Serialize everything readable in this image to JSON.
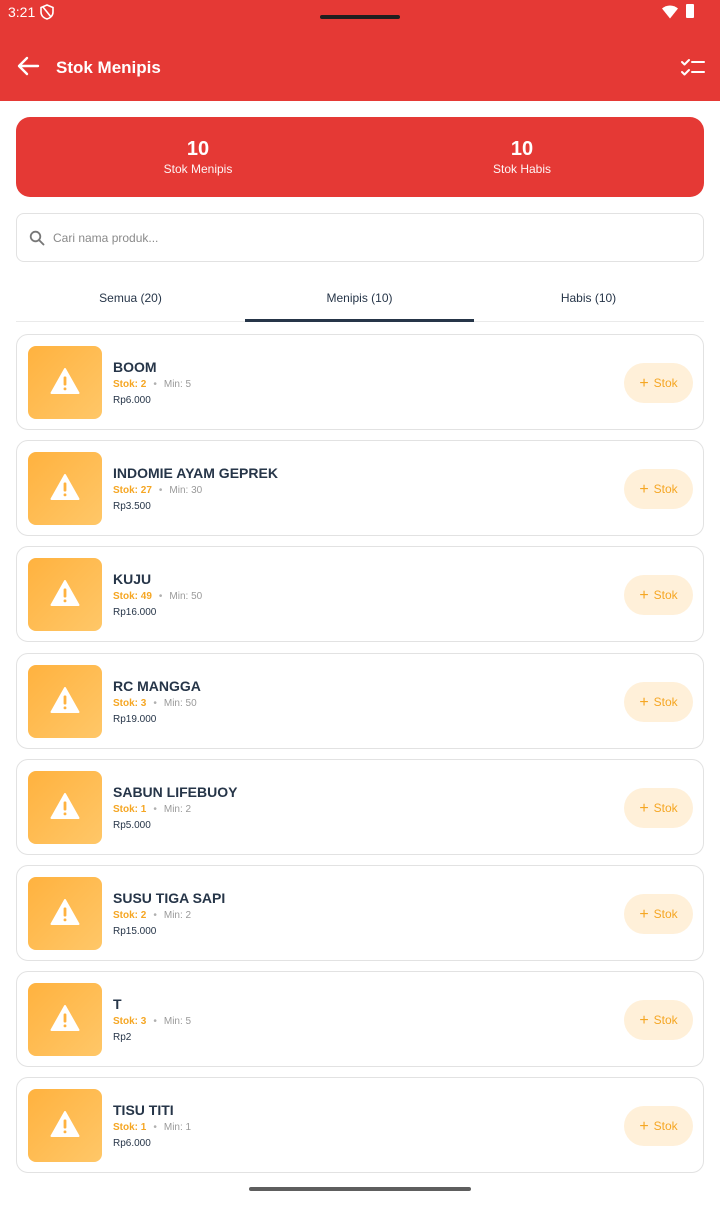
{
  "status_bar": {
    "time": "3:21"
  },
  "header": {
    "title": "Stok Menipis"
  },
  "summary": [
    {
      "value": "10",
      "label": "Stok Menipis"
    },
    {
      "value": "10",
      "label": "Stok Habis"
    }
  ],
  "search": {
    "placeholder": "Cari nama produk...",
    "value": ""
  },
  "tabs": [
    {
      "label": "Semua (20)",
      "active": false
    },
    {
      "label": "Menipis (10)",
      "active": true
    },
    {
      "label": "Habis (10)",
      "active": false
    }
  ],
  "products": [
    {
      "name": "BOOM",
      "stock": "Stok: 2",
      "min": "Min: 5",
      "price": "Rp6.000"
    },
    {
      "name": "INDOMIE AYAM GEPREK",
      "stock": "Stok: 27",
      "min": "Min: 30",
      "price": "Rp3.500"
    },
    {
      "name": "KUJU",
      "stock": "Stok: 49",
      "min": "Min: 50",
      "price": "Rp16.000"
    },
    {
      "name": "RC MANGGA",
      "stock": "Stok: 3",
      "min": "Min: 50",
      "price": "Rp19.000"
    },
    {
      "name": "SABUN LIFEBUOY",
      "stock": "Stok: 1",
      "min": "Min: 2",
      "price": "Rp5.000"
    },
    {
      "name": "SUSU TIGA SAPI",
      "stock": "Stok: 2",
      "min": "Min: 2",
      "price": "Rp15.000"
    },
    {
      "name": "T",
      "stock": "Stok: 3",
      "min": "Min: 5",
      "price": "Rp2"
    },
    {
      "name": "TISU TITI",
      "stock": "Stok: 1",
      "min": "Min: 1",
      "price": "Rp6.000"
    }
  ],
  "add_stock_label": "Stok",
  "separator": "•",
  "icons": {
    "back": "arrow-left-icon",
    "checklist": "checklist-icon",
    "search": "search-icon",
    "product": "warning-icon",
    "add": "plus-icon"
  },
  "colors": {
    "primary": "#e53935",
    "warning": "#f5a623",
    "warning_bg": "#fff0d9",
    "text_dark": "#263548"
  }
}
